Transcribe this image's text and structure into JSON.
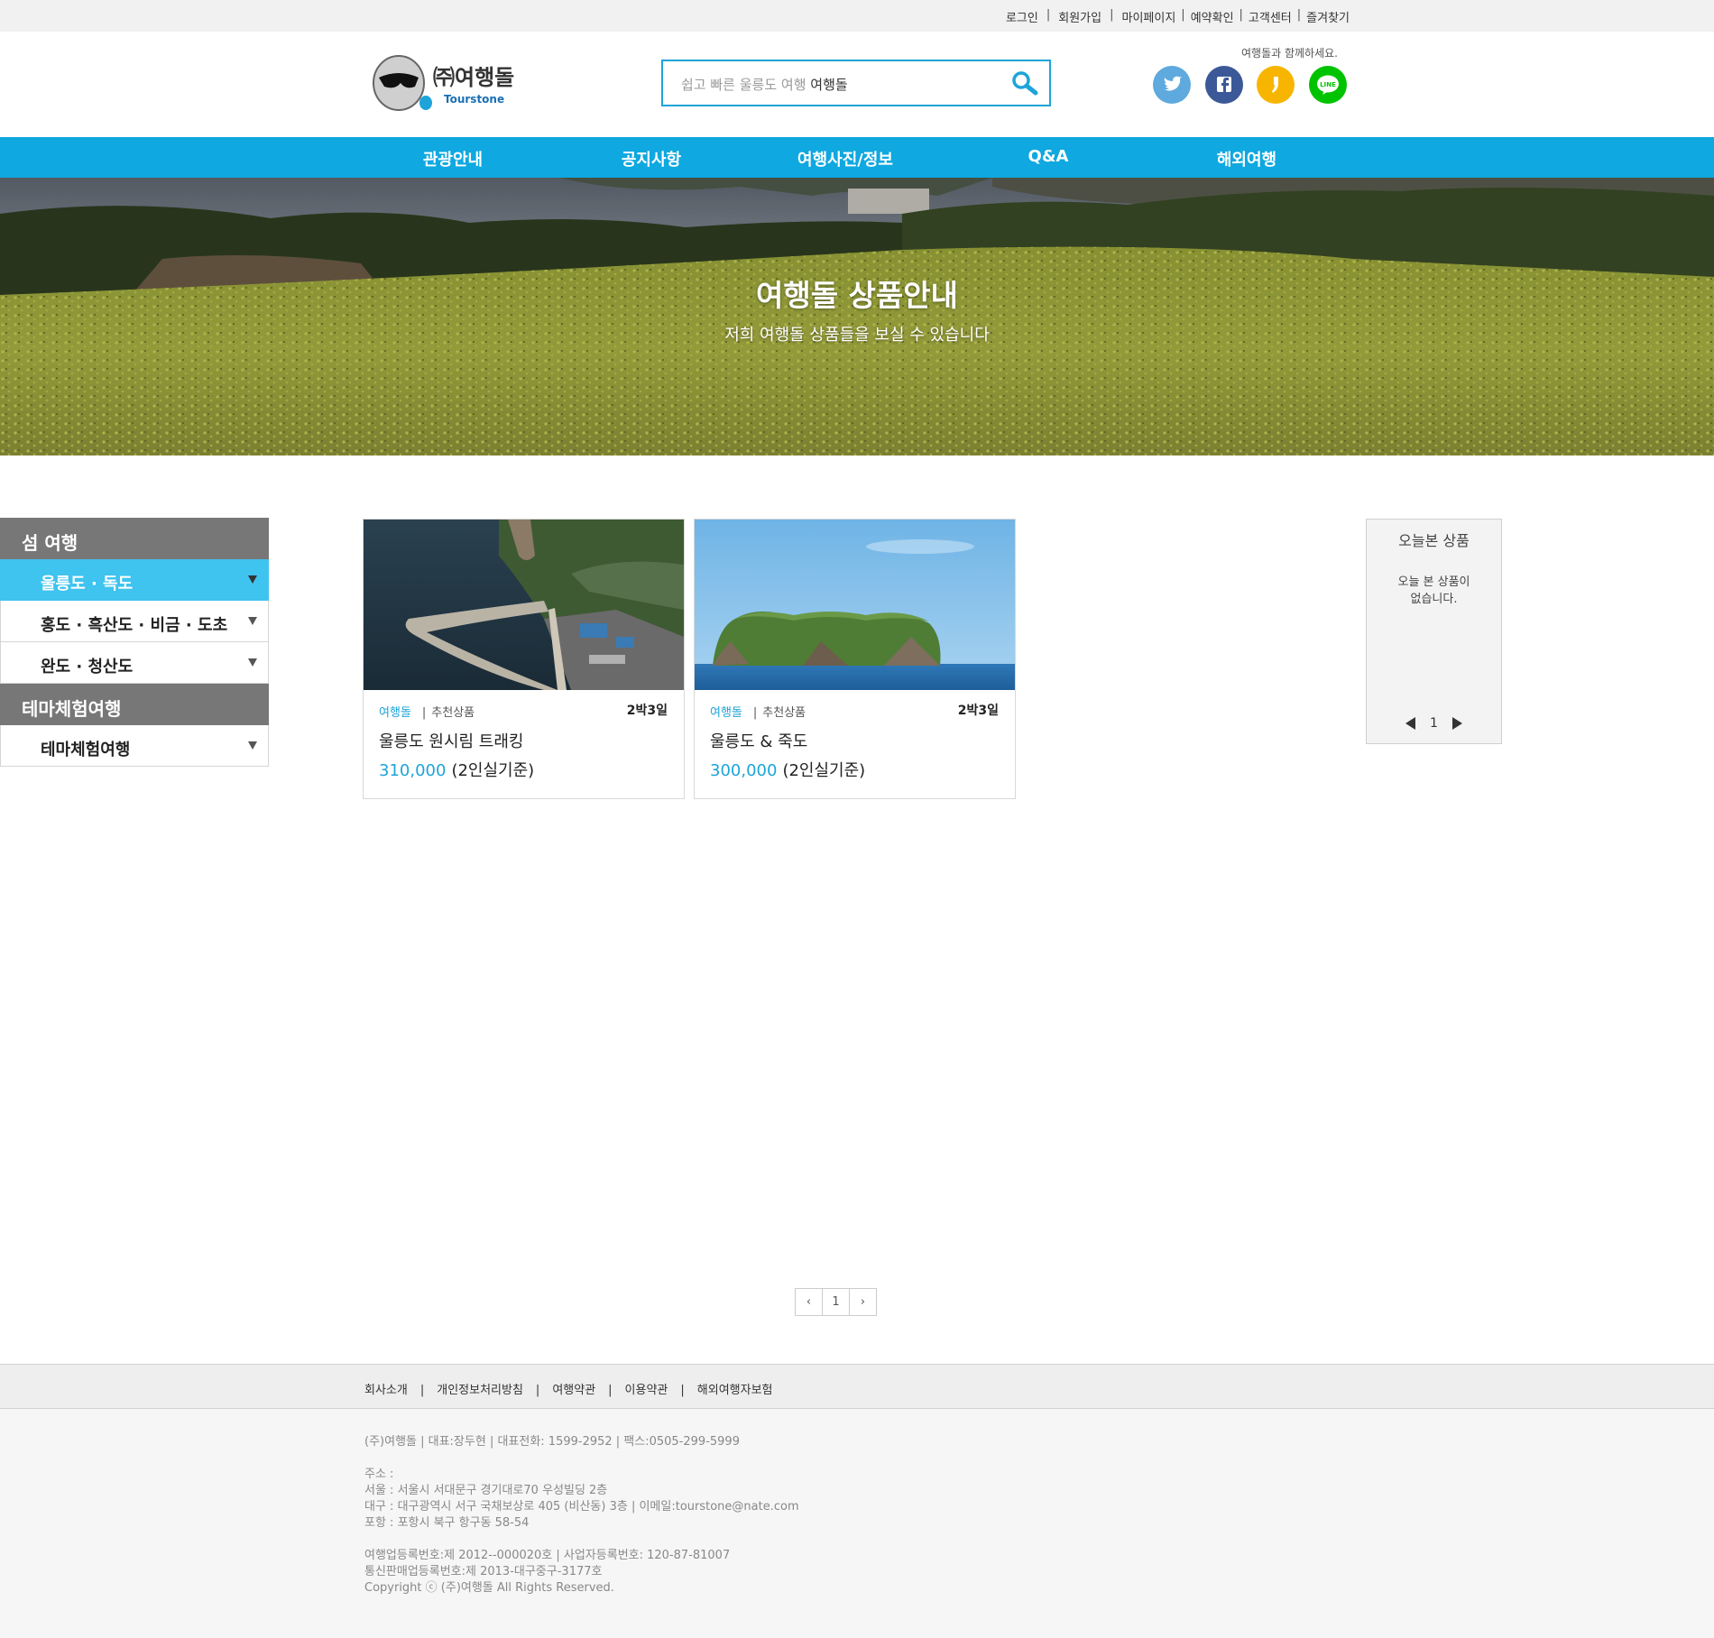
{
  "topbar": {
    "login": "로그인",
    "signup": "회원가입",
    "mypage": "마이페이지",
    "reservation": "예약확인",
    "support": "고객센터",
    "bookmark": "즐겨찾기"
  },
  "header": {
    "logo_brand": "㈜여행돌",
    "logo_sub": "Tourstone",
    "search_placeholder": "쉽고 빠른 울릉도 여행",
    "search_keyword": "여행돌",
    "tagline": "여행돌과 함께하세요.",
    "social": [
      {
        "name": "twitter-icon",
        "color": "#5ea9dd"
      },
      {
        "name": "facebook-icon",
        "color": "#3b5998"
      },
      {
        "name": "kakaostory-icon",
        "color": "#f7b500"
      },
      {
        "name": "line-icon",
        "color": "#00c300"
      }
    ]
  },
  "nav": {
    "items": [
      "관광안내",
      "공지사항",
      "여행사진/정보",
      "Q&A",
      "해외여행"
    ]
  },
  "hero": {
    "title": "여행돌 상품안내",
    "subtitle": "저희 여행돌 상품들을 보실 수 있습니다"
  },
  "sidebar": {
    "group1": "섬 여행",
    "items1": [
      "울릉도 · 독도",
      "홍도 · 흑산도 · 비금 · 도초",
      "완도 · 청산도"
    ],
    "group2": "테마체험여행",
    "items2": [
      "테마체험여행"
    ]
  },
  "products": [
    {
      "brand": "여행돌",
      "tag": "추천상품",
      "days": "2박3일",
      "name": "울릉도 원시림 트래킹",
      "price": "310,000",
      "basis": "(2인실기준)"
    },
    {
      "brand": "여행돌",
      "tag": "추천상품",
      "days": "2박3일",
      "name": "울릉도 & 죽도",
      "price": "300,000",
      "basis": "(2인실기준)"
    }
  ],
  "recent": {
    "title": "오늘본 상품",
    "empty_line1": "오늘 본 상품이",
    "empty_line2": "없습니다.",
    "page": "1"
  },
  "pagination": {
    "prev": "‹",
    "current": "1",
    "next": "›"
  },
  "footer": {
    "links": [
      "회사소개",
      "개인정보처리방침",
      "여행약관",
      "이용약관",
      "해외여행자보험"
    ],
    "company": "(주)여행돌 | 대표:장두현 |  대표전화: 1599-2952  |  팩스:0505-299-5999",
    "address_label": "주소 :",
    "address_seoul": "서울 : 서울시 서대문구 경기대로70 우성빌딩 2층",
    "address_daegu": "대구 : 대구광역시 서구 국채보상로 405 (비산동) 3층 |  이메일:tourstone@nate.com",
    "address_pohang": "포항 : 포항시 북구 항구동 58-54",
    "reg1": "여행업등록번호:제 2012--000020호  |  사업자등록번호: 120-87-81007",
    "reg2": "통신판매업등록번호:제 2013-대구중구-3177호",
    "copyright": "Copyright ⓒ (주)여행돌 All Rights Reserved."
  },
  "colors": {
    "accent": "#0fa8e0",
    "active_menu": "#3fc3ef",
    "price": "#1ea4d9",
    "menu_head": "#777777"
  }
}
